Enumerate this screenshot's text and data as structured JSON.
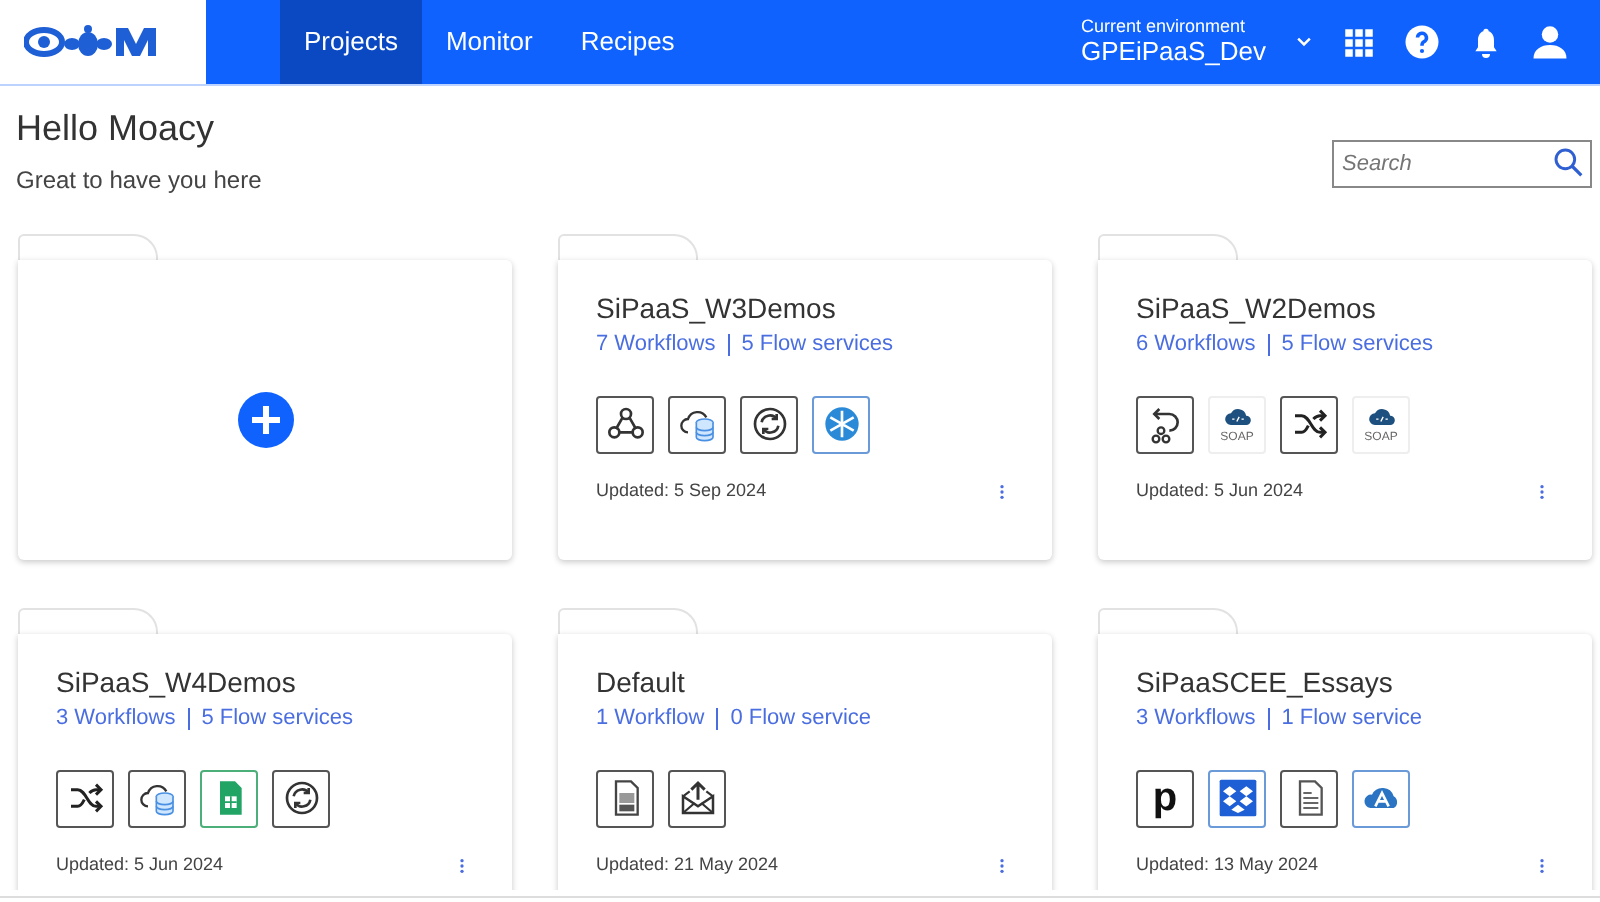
{
  "header": {
    "nav": [
      {
        "label": "Projects",
        "selected": true
      },
      {
        "label": "Monitor",
        "selected": false
      },
      {
        "label": "Recipes",
        "selected": false
      }
    ],
    "environment": {
      "caption": "Current environment",
      "value": "GPEiPaaS_Dev"
    }
  },
  "greeting": {
    "title": "Hello Moacy",
    "subtitle": "Great to have you here"
  },
  "search": {
    "placeholder": "Search"
  },
  "projects": [
    {
      "kind": "new"
    },
    {
      "kind": "project",
      "name": "SiPaaS_W3Demos",
      "workflows": "7 Workflows",
      "services": "5 Flow services",
      "updated": "Updated: 5 Sep 2024",
      "icons": [
        {
          "kind": "webhook"
        },
        {
          "kind": "cloud-db"
        },
        {
          "kind": "sync"
        },
        {
          "kind": "snowflake"
        }
      ]
    },
    {
      "kind": "project",
      "name": "SiPaaS_W2Demos",
      "workflows": "6 Workflows",
      "services": "5 Flow services",
      "updated": "Updated: 5 Jun 2024",
      "icons": [
        {
          "kind": "undo-webhook"
        },
        {
          "kind": "soap",
          "label": "SOAP"
        },
        {
          "kind": "shuffle"
        },
        {
          "kind": "soap",
          "label": "SOAP"
        }
      ]
    },
    {
      "kind": "project",
      "name": "SiPaaS_W4Demos",
      "workflows": "3 Workflows",
      "services": "5 Flow services",
      "updated": "Updated: 5 Jun 2024",
      "icons": [
        {
          "kind": "shuffle"
        },
        {
          "kind": "cloud-db"
        },
        {
          "kind": "sheet"
        },
        {
          "kind": "sync"
        }
      ]
    },
    {
      "kind": "project",
      "name": "Default",
      "workflows": "1 Workflow",
      "services": "0 Flow service",
      "updated": "Updated: 21 May 2024",
      "icons": [
        {
          "kind": "log-file"
        },
        {
          "kind": "mail"
        }
      ]
    },
    {
      "kind": "project",
      "name": "SiPaaSCEE_Essays",
      "workflows": "3 Workflows",
      "services": "1 Flow service",
      "updated": "Updated: 13 May 2024",
      "icons": [
        {
          "kind": "letter",
          "label": "p"
        },
        {
          "kind": "dropbox"
        },
        {
          "kind": "document"
        },
        {
          "kind": "cloud-arrow"
        }
      ]
    }
  ]
}
